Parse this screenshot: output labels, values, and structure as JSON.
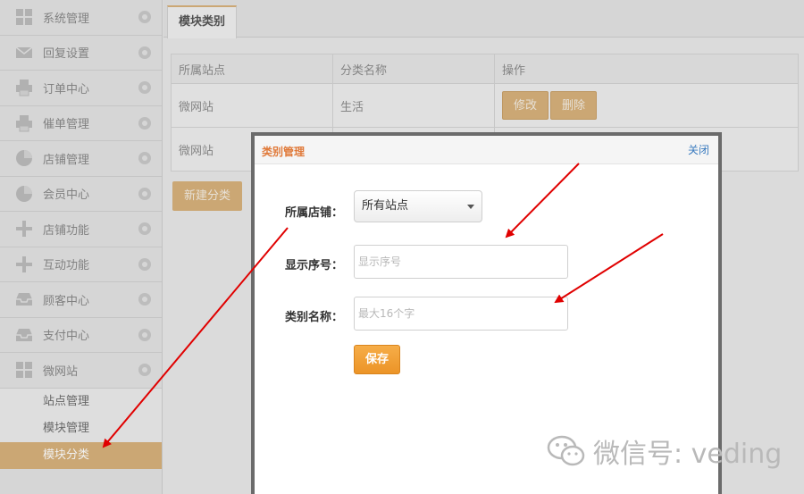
{
  "sidebar": {
    "items": [
      {
        "label": "系统管理",
        "icon": "grid-icon"
      },
      {
        "label": "回复设置",
        "icon": "mail-icon"
      },
      {
        "label": "订单中心",
        "icon": "printer-icon"
      },
      {
        "label": "催单管理",
        "icon": "printer-icon"
      },
      {
        "label": "店铺管理",
        "icon": "pie-chart-icon"
      },
      {
        "label": "会员中心",
        "icon": "pie-chart-icon"
      },
      {
        "label": "店铺功能",
        "icon": "plus-icon"
      },
      {
        "label": "互动功能",
        "icon": "plus-icon"
      },
      {
        "label": "顾客中心",
        "icon": "inbox-icon"
      },
      {
        "label": "支付中心",
        "icon": "inbox-icon"
      },
      {
        "label": "微网站",
        "icon": "grid-icon"
      }
    ],
    "submenu": [
      {
        "label": "站点管理",
        "active": false
      },
      {
        "label": "模块管理",
        "active": false
      },
      {
        "label": "模块分类",
        "active": true
      }
    ]
  },
  "tabs": {
    "active": "模块类别"
  },
  "table": {
    "headers": [
      "所属站点",
      "分类名称",
      "操作"
    ],
    "rows": [
      {
        "site": "微网站",
        "category": "生活",
        "edit": "修改",
        "delete": "删除"
      },
      {
        "site": "微网站",
        "category": "",
        "edit": "",
        "delete": ""
      }
    ]
  },
  "new_category_button": "新建分类",
  "modal": {
    "title": "类别管理",
    "close": "关闭",
    "store_label": "所属店铺：",
    "store_value": "所有站点",
    "order_label": "显示序号：",
    "order_placeholder": "显示序号",
    "name_label": "类别名称：",
    "name_placeholder": "最大16个字",
    "save": "保存"
  },
  "watermark": {
    "text": "微信号: veding"
  },
  "colors": {
    "accent": "#d8b27c",
    "save": "#ec9427",
    "title": "#e07a3a",
    "link": "#3a7bbf",
    "arrow": "#e00000"
  }
}
